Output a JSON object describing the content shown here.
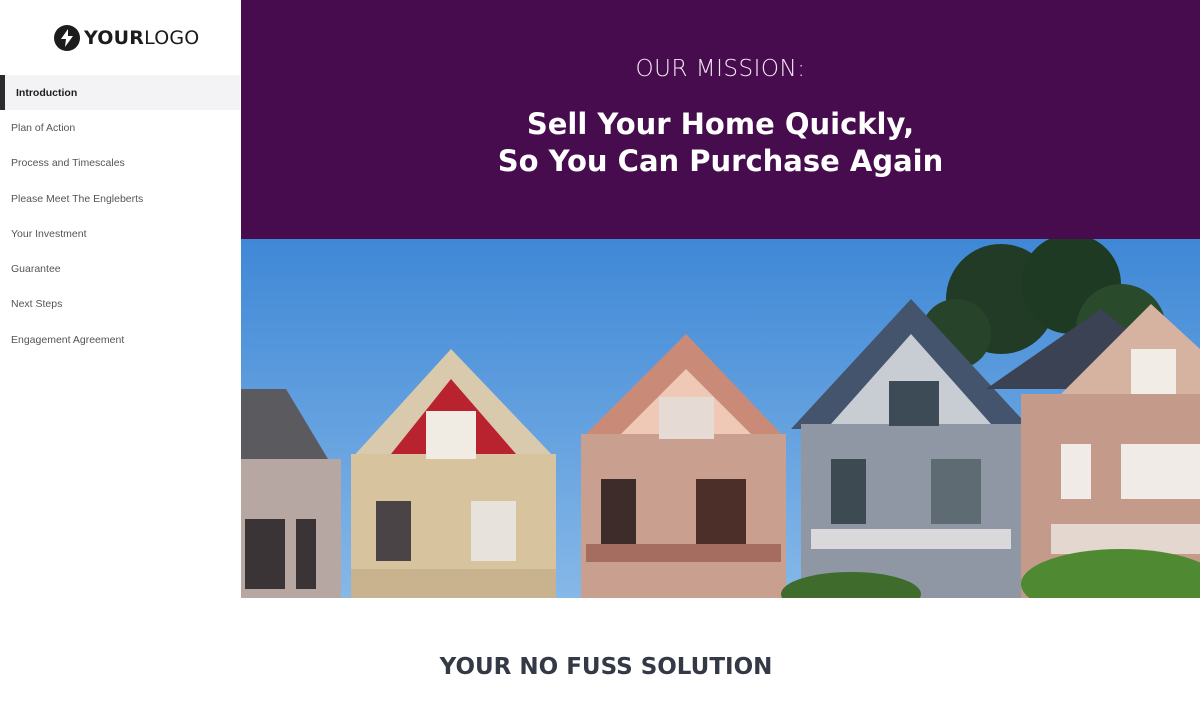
{
  "logo": {
    "icon": "lightning-bolt-icon",
    "text_bold": "YOUR",
    "text_regular": "LOGO"
  },
  "sidebar": {
    "items": [
      {
        "label": "Introduction",
        "active": true
      },
      {
        "label": "Plan of Action"
      },
      {
        "label": "Process and Timescales"
      },
      {
        "label": "Please Meet The Engleberts"
      },
      {
        "label": "Your Investment"
      },
      {
        "label": "Guarantee"
      },
      {
        "label": "Next Steps"
      },
      {
        "label": "Engagement Agreement"
      }
    ]
  },
  "hero": {
    "kicker": "OUR MISSION:",
    "title_line1": "Sell Your Home Quickly,",
    "title_line2": "So You Can Purchase Again",
    "background": "#470c4d"
  },
  "section": {
    "title": "YOUR NO FUSS SOLUTION"
  }
}
